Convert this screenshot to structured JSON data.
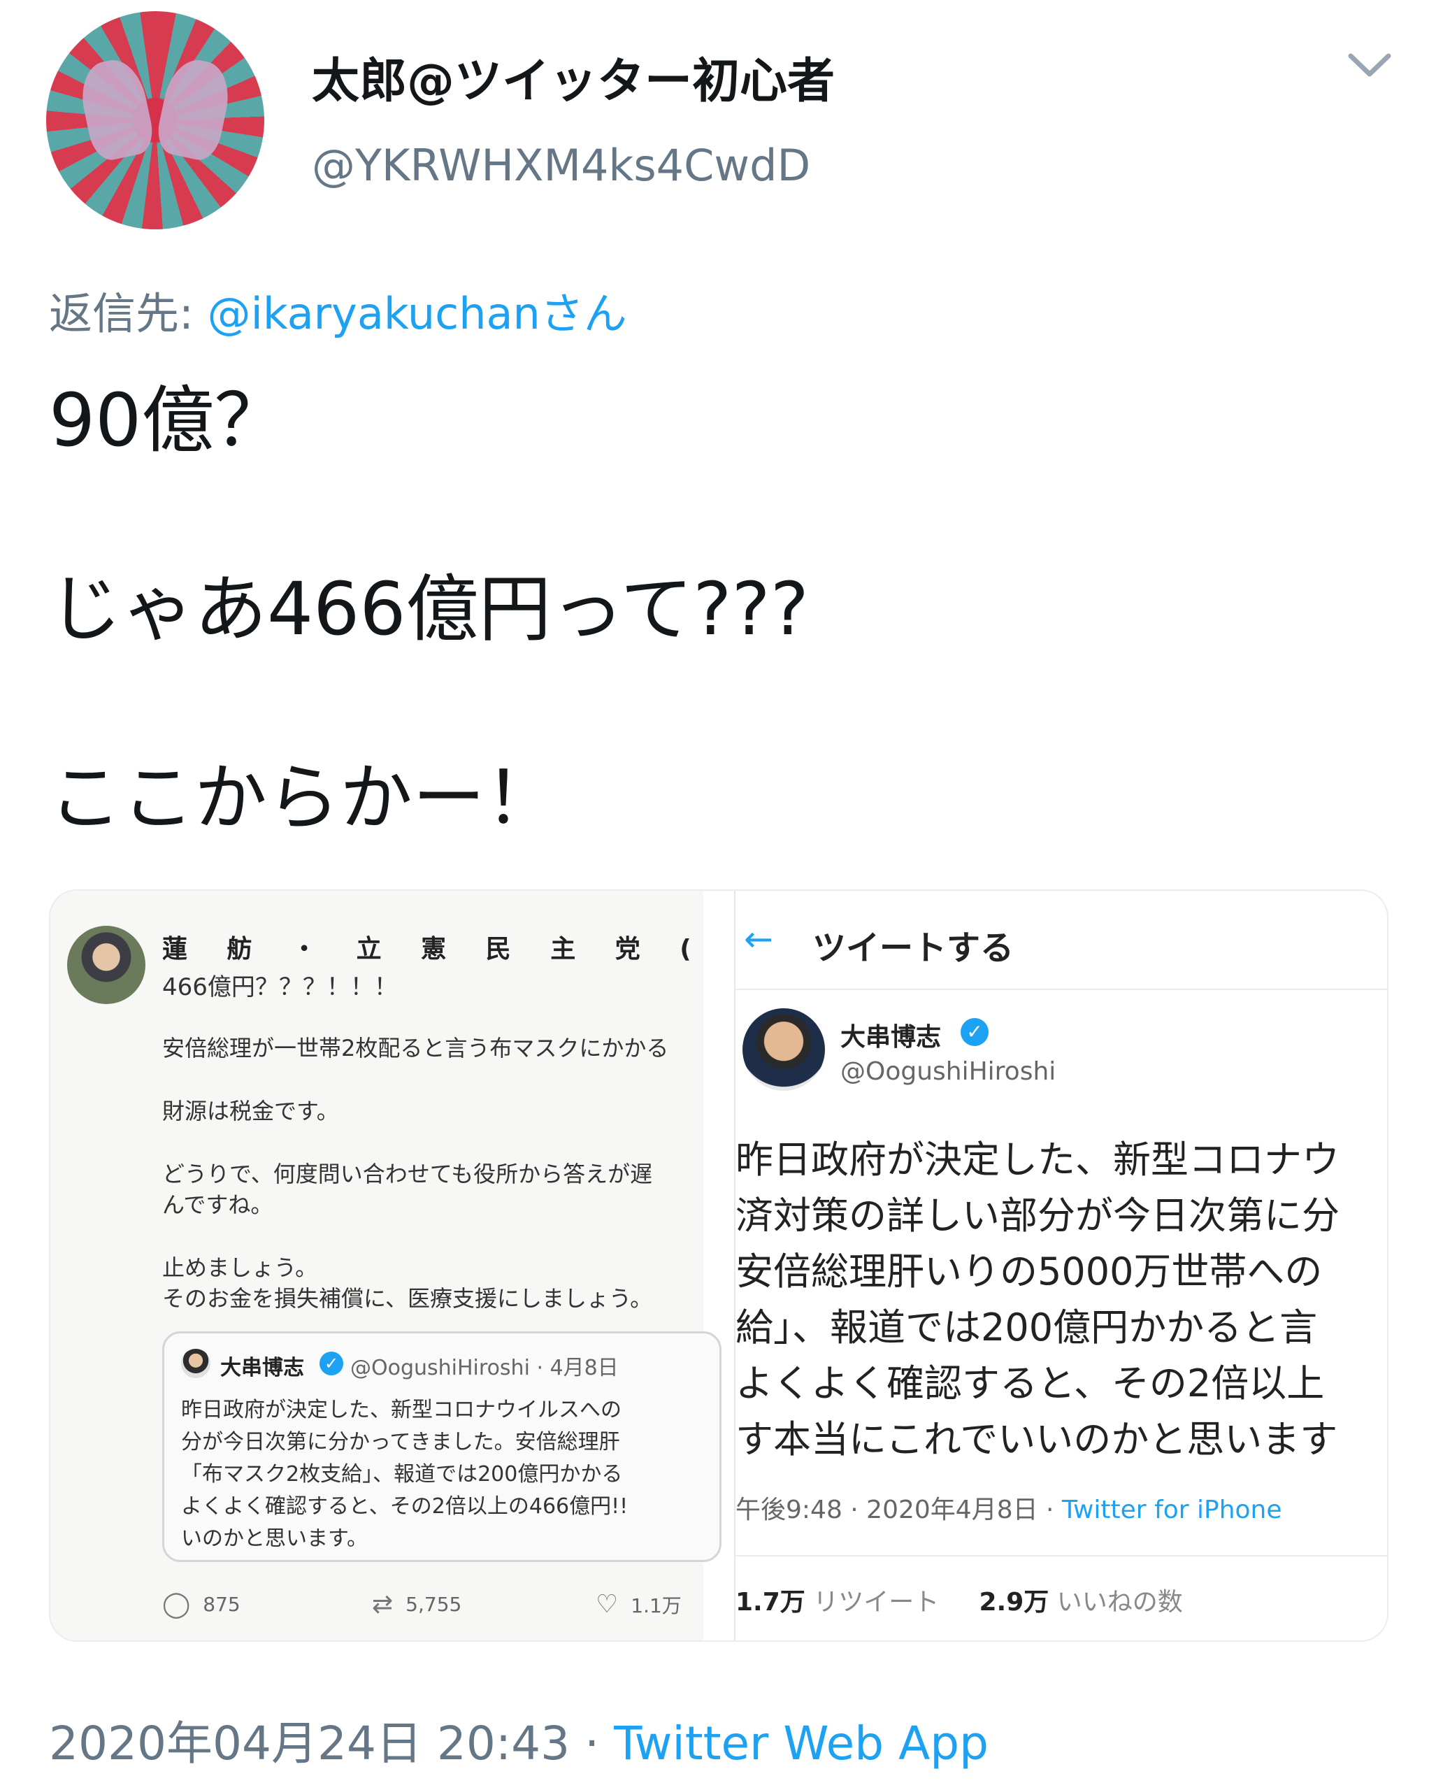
{
  "header": {
    "display_name": "太郎@ツイッター初心者",
    "handle": "@YKRWHXM4ks4CwdD"
  },
  "reply": {
    "prefix": "返信先:",
    "mention": "@ikaryakuchanさん"
  },
  "tweet": {
    "lines": [
      "90億？",
      "じゃあ466億円って???",
      "ここからかー！"
    ]
  },
  "left_image": {
    "author": "蓮 舫 ・ 立 憲 民 主 党 ( り っ け",
    "lines": [
      "466億円？？？！！！",
      "安倍総理が一世帯2枚配ると言う布マスクにかかる",
      "財源は税金です。",
      "どうりで、何度問い合わせても役所から答えが遅",
      "んですね。",
      "止めましょう。",
      "そのお金を損失補償に、医療支援にしましょう。"
    ],
    "quote": {
      "name": "大串博志",
      "verified": "✓",
      "handle_date": "@OogushiHiroshi · 4月8日",
      "lines": [
        "昨日政府が決定した、新型コロナウイルスへの",
        "分が今日次第に分かってきました。安倍総理肝",
        "「布マスク2枚支給」、報道では200億円かかる",
        "よくよく確認すると、その2倍以上の466億円!!",
        "いのかと思います。"
      ]
    },
    "stats": {
      "replies": "875",
      "retweets": "5,755",
      "likes": "1.1万",
      "reply_icon": "speech-bubble-icon",
      "retweet_icon": "retweet-icon",
      "like_icon": "heart-icon"
    }
  },
  "right_image": {
    "back_icon": "←",
    "title": "ツイートする",
    "name": "大串博志",
    "verified": "✓",
    "handle": "@OogushiHiroshi",
    "lines": [
      "昨日政府が決定した、新型コロナウ",
      "済対策の詳しい部分が今日次第に分",
      "安倍総理肝いりの5000万世帯への",
      "給」、報道では200億円かかると言",
      "よくよく確認すると、その2倍以上",
      "す本当にこれでいいのかと思います"
    ],
    "meta": "午後9:48 · 2020年4月8日 · ",
    "source": "Twitter for iPhone",
    "retweets_count": "1.7万",
    "retweets_label": "リツイート",
    "likes_count": "2.9万",
    "likes_label": "いいねの数"
  },
  "footer": {
    "timestamp": "2020年04月24日 20:43 · ",
    "app": "Twitter Web App"
  },
  "colors": {
    "link": "#1da1f2",
    "secondary_text": "#657786",
    "primary_text": "#14171a"
  }
}
